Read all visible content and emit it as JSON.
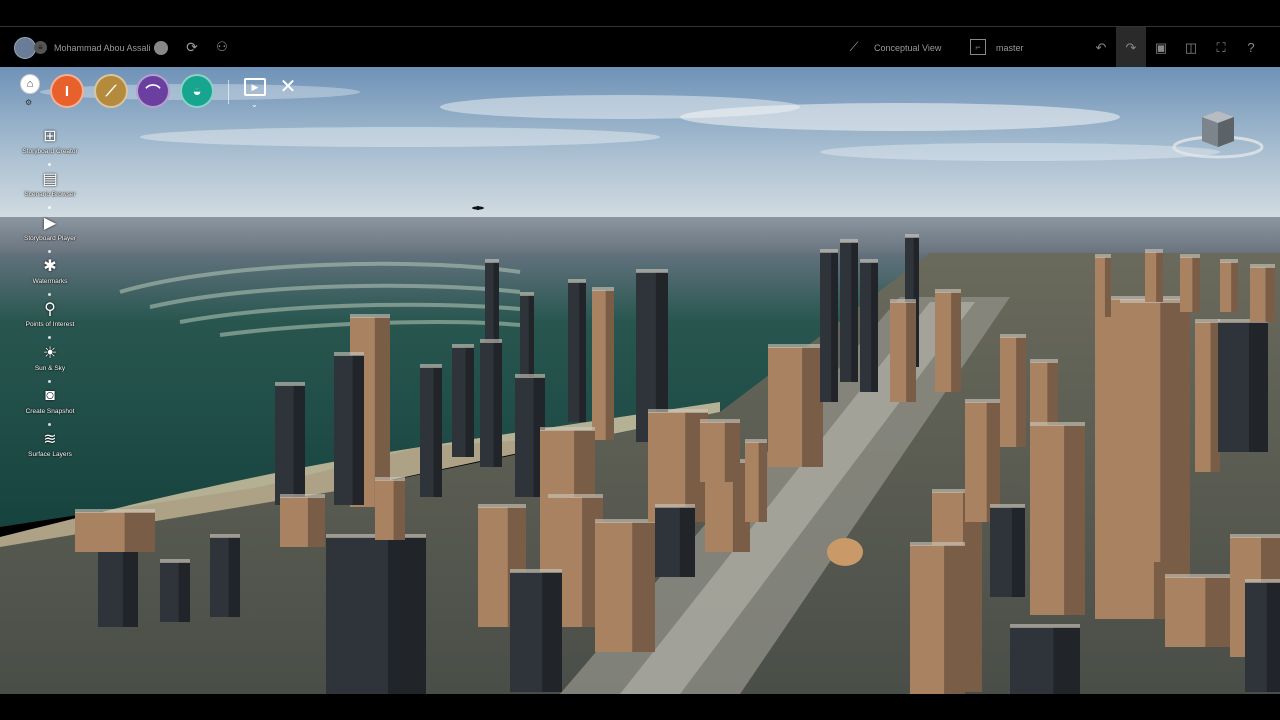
{
  "topbar": {
    "user_name": "Mohammad Abou Assali",
    "view_mode_label": "Conceptual View",
    "branch_label": "master",
    "right_buttons": [
      {
        "name": "undo-button",
        "glyph": "↶"
      },
      {
        "name": "redo-button",
        "glyph": "↷"
      },
      {
        "name": "layout-button",
        "glyph": "▣"
      },
      {
        "name": "panels-button",
        "glyph": "◫"
      },
      {
        "name": "fullscreen-button",
        "glyph": "⛶"
      },
      {
        "name": "help-button",
        "glyph": "?"
      }
    ]
  },
  "apps": [
    {
      "name": "app-orange",
      "color": "#e8602c",
      "glyph": "I"
    },
    {
      "name": "app-road",
      "color": "#b48a3c",
      "glyph": "⟋"
    },
    {
      "name": "app-bridge",
      "color": "#6b3fa0",
      "glyph": "⌒"
    },
    {
      "name": "app-water",
      "color": "#18a58f",
      "glyph": "◒"
    }
  ],
  "side_tools": [
    {
      "label": "Storyboard Creator",
      "icon": "storyboard-creator-icon",
      "glyph": "⊞"
    },
    {
      "label": "Scenario Browser",
      "icon": "scenario-browser-icon",
      "glyph": "▤"
    },
    {
      "label": "Storyboard Player",
      "icon": "storyboard-player-icon",
      "glyph": "▶"
    },
    {
      "label": "Watermarks",
      "icon": "watermark-icon",
      "glyph": "✱"
    },
    {
      "label": "Points of Interest",
      "icon": "point-of-interest-icon",
      "glyph": "⚲"
    },
    {
      "label": "Sun & Sky",
      "icon": "sun-sky-icon",
      "glyph": "☀"
    },
    {
      "label": "Create Snapshot",
      "icon": "camera-icon",
      "glyph": "◙"
    },
    {
      "label": "Surface Layers",
      "icon": "layers-icon",
      "glyph": "≋"
    }
  ],
  "colors": {
    "sky_top": "#6f93b8",
    "sky_horizon": "#c9d6df",
    "sea": "#1f5e5a",
    "tower_dark": "#2f343b",
    "tower_tan": "#a98262"
  }
}
